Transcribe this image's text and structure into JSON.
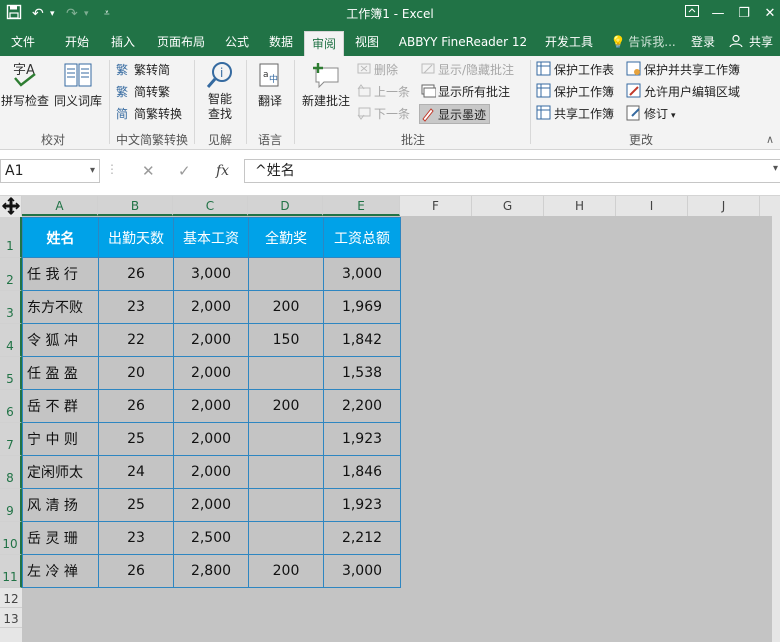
{
  "window": {
    "title": "工作簿1 - Excel",
    "qat_save_icon": "save-icon",
    "qat_undo_icon": "undo-icon",
    "qat_redo_icon": "redo-icon",
    "qat_customize_icon": "customize-qat-icon"
  },
  "tabs": [
    {
      "label": "文件"
    },
    {
      "label": "开始"
    },
    {
      "label": "插入"
    },
    {
      "label": "页面布局"
    },
    {
      "label": "公式"
    },
    {
      "label": "数据"
    },
    {
      "label": "审阅",
      "active": true
    },
    {
      "label": "视图"
    },
    {
      "label": "ABBYY FineReader 12"
    },
    {
      "label": "开发工具"
    },
    {
      "label": "告诉我..."
    },
    {
      "label": "登录"
    },
    {
      "label": "共享"
    }
  ],
  "ribbon": {
    "proofing": {
      "spell_check": "拼写检查",
      "thesaurus": "同义词库",
      "group_label": "校对"
    },
    "chinese": {
      "to_simplified": "繁转简",
      "to_traditional": "简转繁",
      "convert": "简繁转换",
      "group_label": "中文简繁转换"
    },
    "insights": {
      "smart_lookup": "智能查找",
      "group_label": "见解"
    },
    "language": {
      "translate": "翻译",
      "group_label": "语言"
    },
    "comments": {
      "new_comment": "新建批注",
      "delete": "删除",
      "previous": "上一条",
      "next": "下一条",
      "show_hide": "显示/隐藏批注",
      "show_all": "显示所有批注",
      "show_ink": "显示墨迹",
      "group_label": "批注"
    },
    "changes": {
      "protect_sheet": "保护工作表",
      "protect_workbook": "保护工作簿",
      "share_workbook": "共享工作簿",
      "protect_share": "保护并共享工作簿",
      "allow_edit": "允许用户编辑区域",
      "track_changes": "修订",
      "group_label": "更改"
    }
  },
  "formula_bar": {
    "name_box": "A1",
    "cancel": "✕",
    "enter": "✓",
    "fx": "fx",
    "content": "^姓名"
  },
  "grid": {
    "columns": [
      "A",
      "B",
      "C",
      "D",
      "E",
      "F",
      "G",
      "H",
      "I",
      "J"
    ],
    "rows": [
      "1",
      "2",
      "3",
      "4",
      "5",
      "6",
      "7",
      "8",
      "9",
      "10",
      "11",
      "12",
      "13"
    ],
    "headers": [
      "姓名",
      "出勤天数",
      "基本工资",
      "全勤奖",
      "工资总额"
    ],
    "data": [
      [
        "任 我 行",
        "26",
        "3,000",
        "",
        "3,000"
      ],
      [
        "东方不败",
        "23",
        "2,000",
        "200",
        "1,969"
      ],
      [
        "令 狐 冲",
        "22",
        "2,000",
        "150",
        "1,842"
      ],
      [
        "任 盈 盈",
        "20",
        "2,000",
        "",
        "1,538"
      ],
      [
        "岳 不 群",
        "26",
        "2,000",
        "200",
        "2,200"
      ],
      [
        "宁 中 则",
        "25",
        "2,000",
        "",
        "1,923"
      ],
      [
        "定闲师太",
        "24",
        "2,000",
        "",
        "1,846"
      ],
      [
        "风 清 扬",
        "25",
        "2,000",
        "",
        "1,923"
      ],
      [
        "岳 灵 珊",
        "23",
        "2,500",
        "",
        "2,212"
      ],
      [
        "左 冷 禅",
        "26",
        "2,800",
        "200",
        "3,000"
      ]
    ]
  },
  "colors": {
    "excel_green": "#217346",
    "header_fill": "#00a2e8",
    "cell_fill": "#c4c4c4",
    "border": "#2e86c1"
  }
}
